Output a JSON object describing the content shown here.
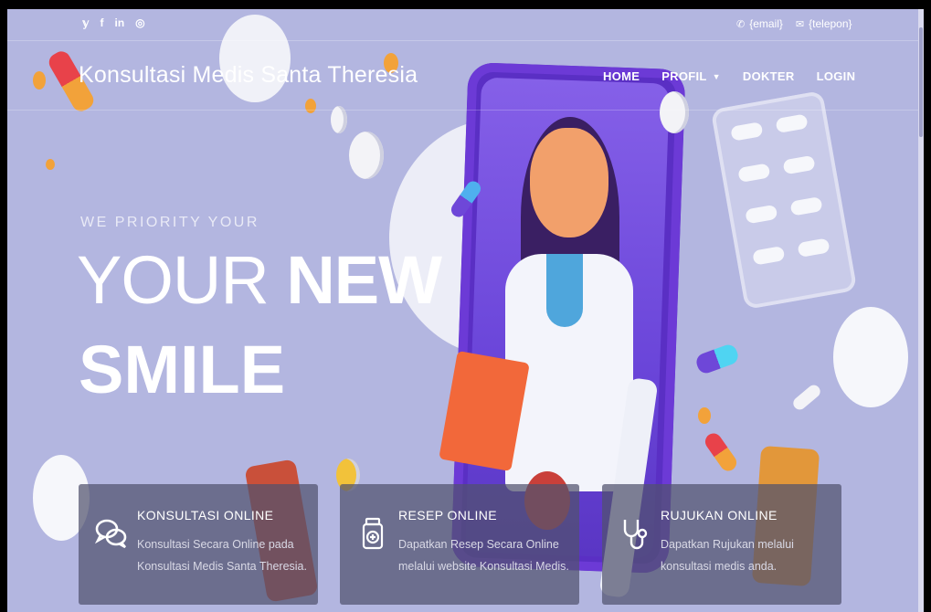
{
  "topbar": {
    "social_icons": [
      "twitter-icon",
      "facebook-icon",
      "linkedin-icon",
      "instagram-icon"
    ],
    "social_glyphs": {
      "twitter": "𝕪",
      "facebook": "f",
      "linkedin": "in",
      "instagram": "◎"
    },
    "email": "{email}",
    "phone": "{telepon}"
  },
  "nav": {
    "brand": "Konsultasi Medis Santa Theresia",
    "items": [
      {
        "label": "HOME"
      },
      {
        "label": "PROFIL"
      },
      {
        "label": "DOKTER"
      },
      {
        "label": "LOGIN"
      }
    ]
  },
  "hero": {
    "kicker": "WE PRIORITY YOUR",
    "line1_light": "YOUR ",
    "line1_bold": "NEW",
    "line2": "SMILE"
  },
  "services": [
    {
      "title": "KONSULTASI ONLINE",
      "desc": "Konsultasi Secara Online pada Konsultasi Medis Santa Theresia.",
      "icon": "chat-bubbles-icon"
    },
    {
      "title": "RESEP ONLINE",
      "desc": "Dapatkan Resep Secara Online melalui website Konsultasi Medis.",
      "icon": "medicine-bottle-icon"
    },
    {
      "title": "RUJUKAN ONLINE",
      "desc": "Dapatkan Rujukan melalui konsultasi medis anda.",
      "icon": "stethoscope-icon"
    }
  ],
  "colors": {
    "background": "#b3b6e0",
    "card": "#50526e",
    "phone": "#5a2fc4",
    "accent_orange": "#f2a23a"
  }
}
